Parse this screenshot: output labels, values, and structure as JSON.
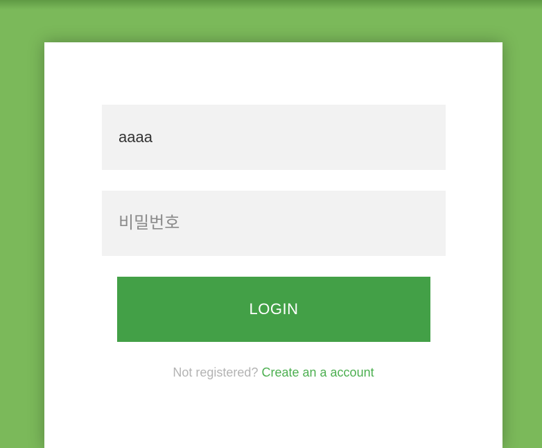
{
  "login_form": {
    "username_value": "aaaa",
    "password_placeholder": "비밀번호",
    "login_label": "LOGIN",
    "register_prompt": "Not registered?",
    "register_link": "Create an a account"
  },
  "colors": {
    "background": "#7bb95a",
    "button": "#43a047",
    "link": "#4caf50"
  }
}
